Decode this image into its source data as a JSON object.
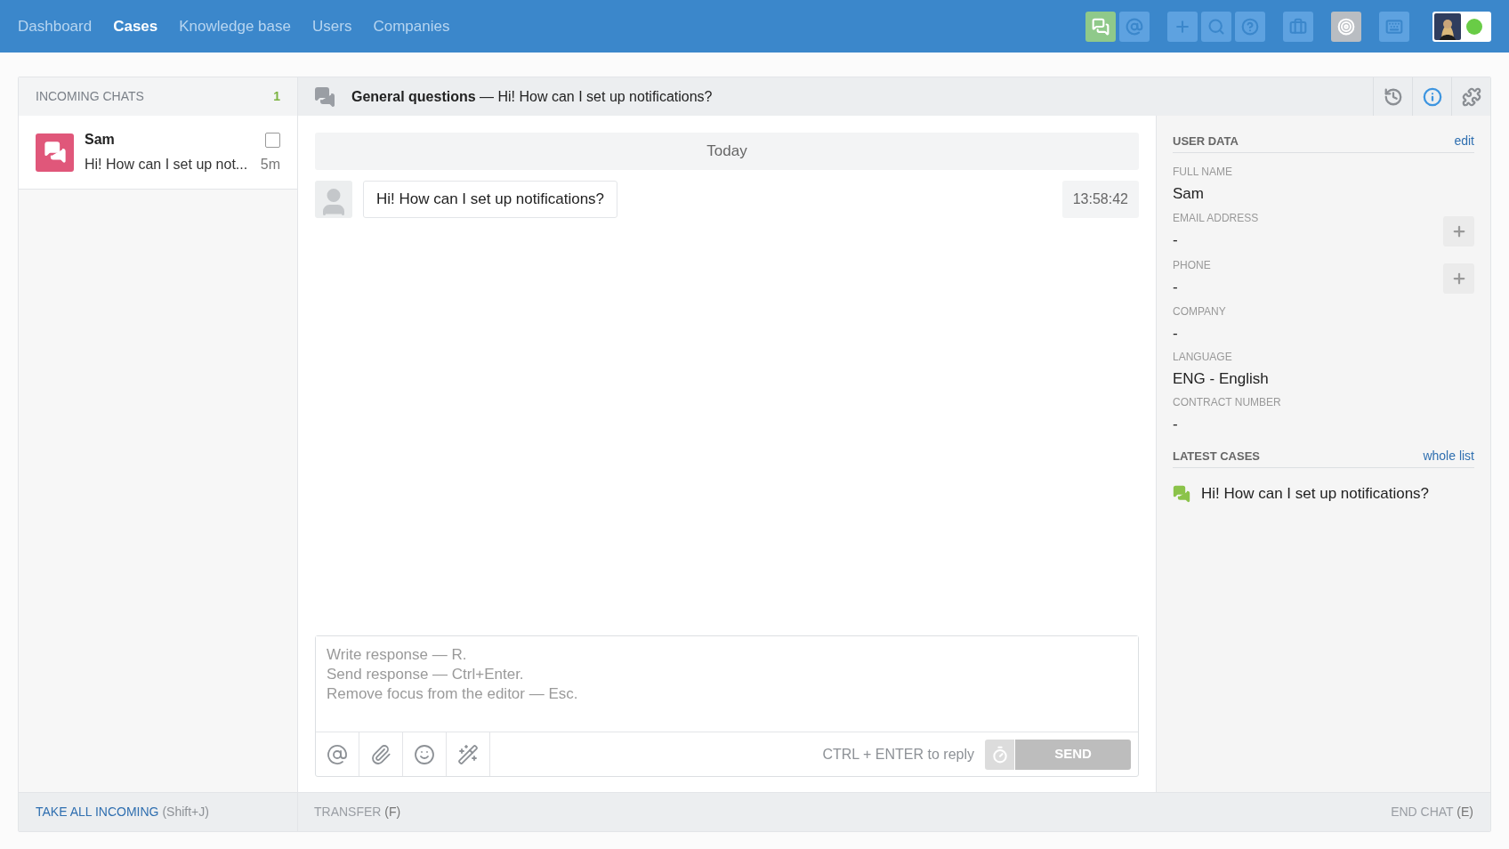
{
  "nav": [
    {
      "label": "Dashboard",
      "selected": false
    },
    {
      "label": "Cases",
      "selected": true
    },
    {
      "label": "Knowledge base",
      "selected": false
    },
    {
      "label": "Users",
      "selected": false
    },
    {
      "label": "Companies",
      "selected": false
    }
  ],
  "toolbar": [
    {
      "kind": "chats",
      "selected": true
    },
    {
      "kind": "mention",
      "selected": false
    },
    {
      "kind": "add",
      "selected": false
    },
    {
      "kind": "search",
      "selected": false
    },
    {
      "kind": "help",
      "selected": false
    },
    {
      "kind": "briefcase",
      "selected": false
    },
    {
      "kind": "target",
      "selected": false
    },
    {
      "kind": "keyboard",
      "selected": false
    }
  ],
  "user_status": {
    "online": true
  },
  "incoming": {
    "title": "INCOMING CHATS",
    "count": "1",
    "chats": [
      {
        "name": "Sam",
        "preview": "Hi! How can I set up not...",
        "time": "5m",
        "checked": false
      }
    ]
  },
  "chat_header": {
    "group": "General questions",
    "separator": "—",
    "subject": "Hi! How can I set up notifications?"
  },
  "side_tabs": [
    {
      "kind": "history",
      "selected": false
    },
    {
      "kind": "info",
      "selected": true
    },
    {
      "kind": "plugins",
      "selected": false
    }
  ],
  "day_divider": "Today",
  "messages": [
    {
      "text": "Hi! How can I set up notifications?",
      "time": "13:58:42"
    }
  ],
  "composer": {
    "placeholder": "Write response — R.\nSend response — Ctrl+Enter.\nRemove focus from the editor — Esc.",
    "hint": "CTRL + ENTER to reply",
    "send": "SEND",
    "send_disabled": true
  },
  "user_data": {
    "title": "USER DATA",
    "link": "edit",
    "fields": [
      {
        "label": "FULL NAME",
        "value": "Sam",
        "addable": false
      },
      {
        "label": "EMAIL ADDRESS",
        "value": "-",
        "addable": true
      },
      {
        "label": "PHONE",
        "value": "-",
        "addable": true
      },
      {
        "label": "COMPANY",
        "value": "-",
        "addable": false
      },
      {
        "label": "LANGUAGE",
        "value": "ENG - English",
        "addable": false
      },
      {
        "label": "CONTRACT NUMBER",
        "value": "-",
        "addable": false
      }
    ]
  },
  "latest_cases": {
    "title": "LATEST CASES",
    "link": "whole list",
    "cases": [
      {
        "text": "Hi! How can I set up notifications?"
      }
    ]
  },
  "footer": {
    "take_all": {
      "label": "TAKE ALL INCOMING",
      "shortcut": "(Shift+J)"
    },
    "transfer": {
      "label": "TRANSFER",
      "shortcut": "(F)"
    },
    "end_chat": {
      "label": "END CHAT",
      "shortcut": "(E)"
    }
  }
}
